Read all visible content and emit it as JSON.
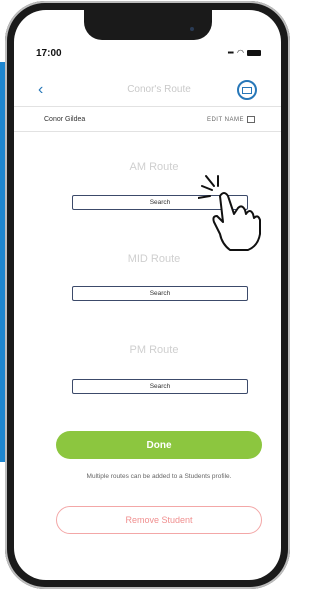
{
  "status": {
    "time": "17:00"
  },
  "header": {
    "title": "Conor's Route"
  },
  "student": {
    "name": "Conor Gildea",
    "edit_label": "EDIT NAME"
  },
  "routes": [
    {
      "label": "AM Route",
      "search": "Search"
    },
    {
      "label": "MID Route",
      "search": "Search"
    },
    {
      "label": "PM Route",
      "search": "Search"
    }
  ],
  "actions": {
    "done": "Done",
    "note": "Multiple routes can be added to a Students profile.",
    "remove": "Remove Student"
  },
  "colors": {
    "accent": "#2777b8",
    "done": "#8cc63f",
    "remove": "#f08f8f",
    "strip": "#1e86cf"
  },
  "icons": {
    "back": "back-chevron-icon",
    "mail": "mail-icon",
    "edit": "edit-icon",
    "pointer": "hand-pointer-icon"
  }
}
